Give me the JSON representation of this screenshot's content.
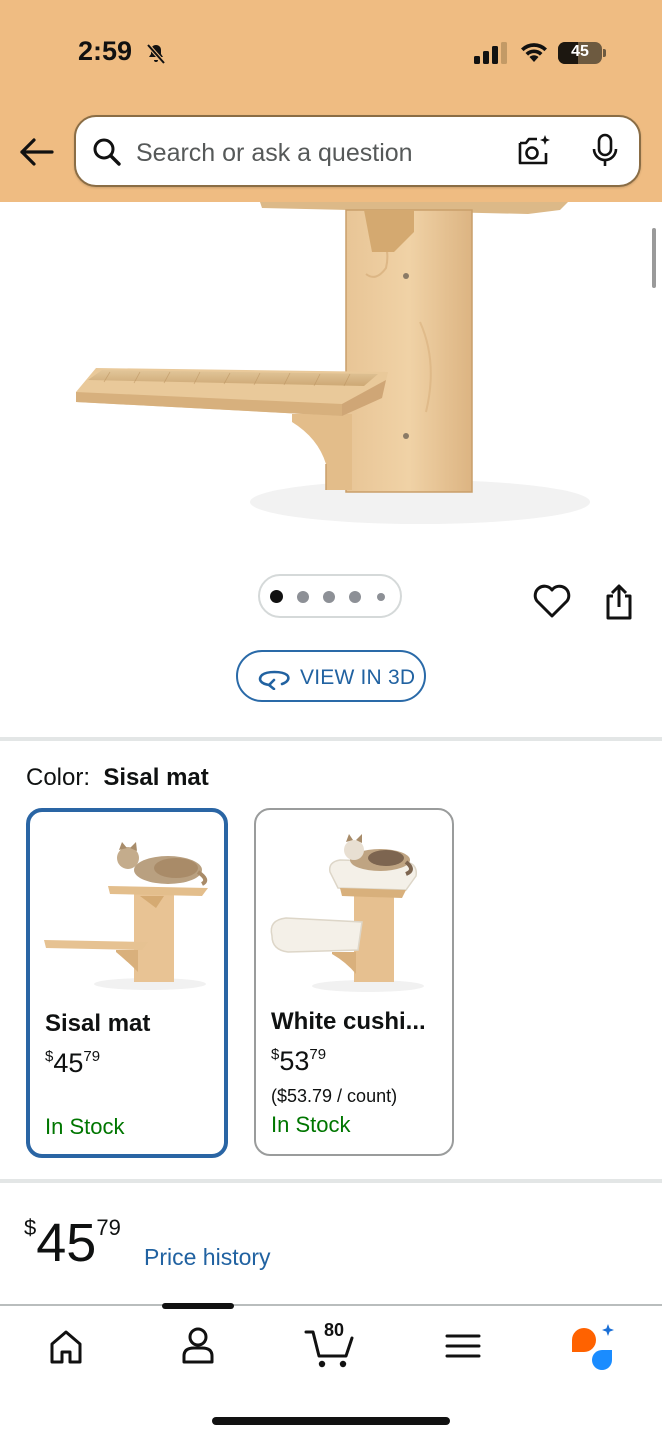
{
  "status_bar": {
    "time": "2:59",
    "battery": "45",
    "battery_level_percent": 45,
    "icons": [
      "bell-slash-icon",
      "cellular-signal-icon",
      "wifi-icon",
      "battery-icon"
    ]
  },
  "header": {
    "background_color": "#efbc82",
    "back_icon": "arrow-left-icon",
    "search": {
      "placeholder": "Search or ask a question",
      "icons": [
        "search-icon",
        "camera-lens-icon",
        "microphone-icon"
      ]
    }
  },
  "gallery": {
    "total_images": 5,
    "current_index": 0,
    "actions": [
      "heart-icon",
      "share-icon"
    ],
    "view_3d_label": "VIEW IN 3D"
  },
  "variations": {
    "label": "Color:",
    "selected_value": "Sisal mat",
    "options": [
      {
        "name": "Sisal mat",
        "price_dollars": "45",
        "price_cents": "79",
        "price_symbol": "$",
        "unit_price": "",
        "stock": "In Stock",
        "selected": true
      },
      {
        "name": "White cushi...",
        "price_dollars": "53",
        "price_cents": "79",
        "price_symbol": "$",
        "unit_price": "($53.79 / count)",
        "stock": "In Stock",
        "selected": false
      }
    ]
  },
  "price": {
    "symbol": "$",
    "whole": "45",
    "fraction": "79",
    "history_link": "Price history"
  },
  "bottom_nav": {
    "items": [
      "home-icon",
      "account-icon",
      "cart-icon",
      "menu-icon",
      "rufus-assistant-icon"
    ],
    "cart_count": "80",
    "active_index": 1
  },
  "colors": {
    "link_blue": "#2162a1",
    "selected_border": "#2a65a4",
    "in_stock_green": "#007600",
    "rufus_orange": "#ff6200",
    "rufus_blue": "#1a8cff"
  }
}
